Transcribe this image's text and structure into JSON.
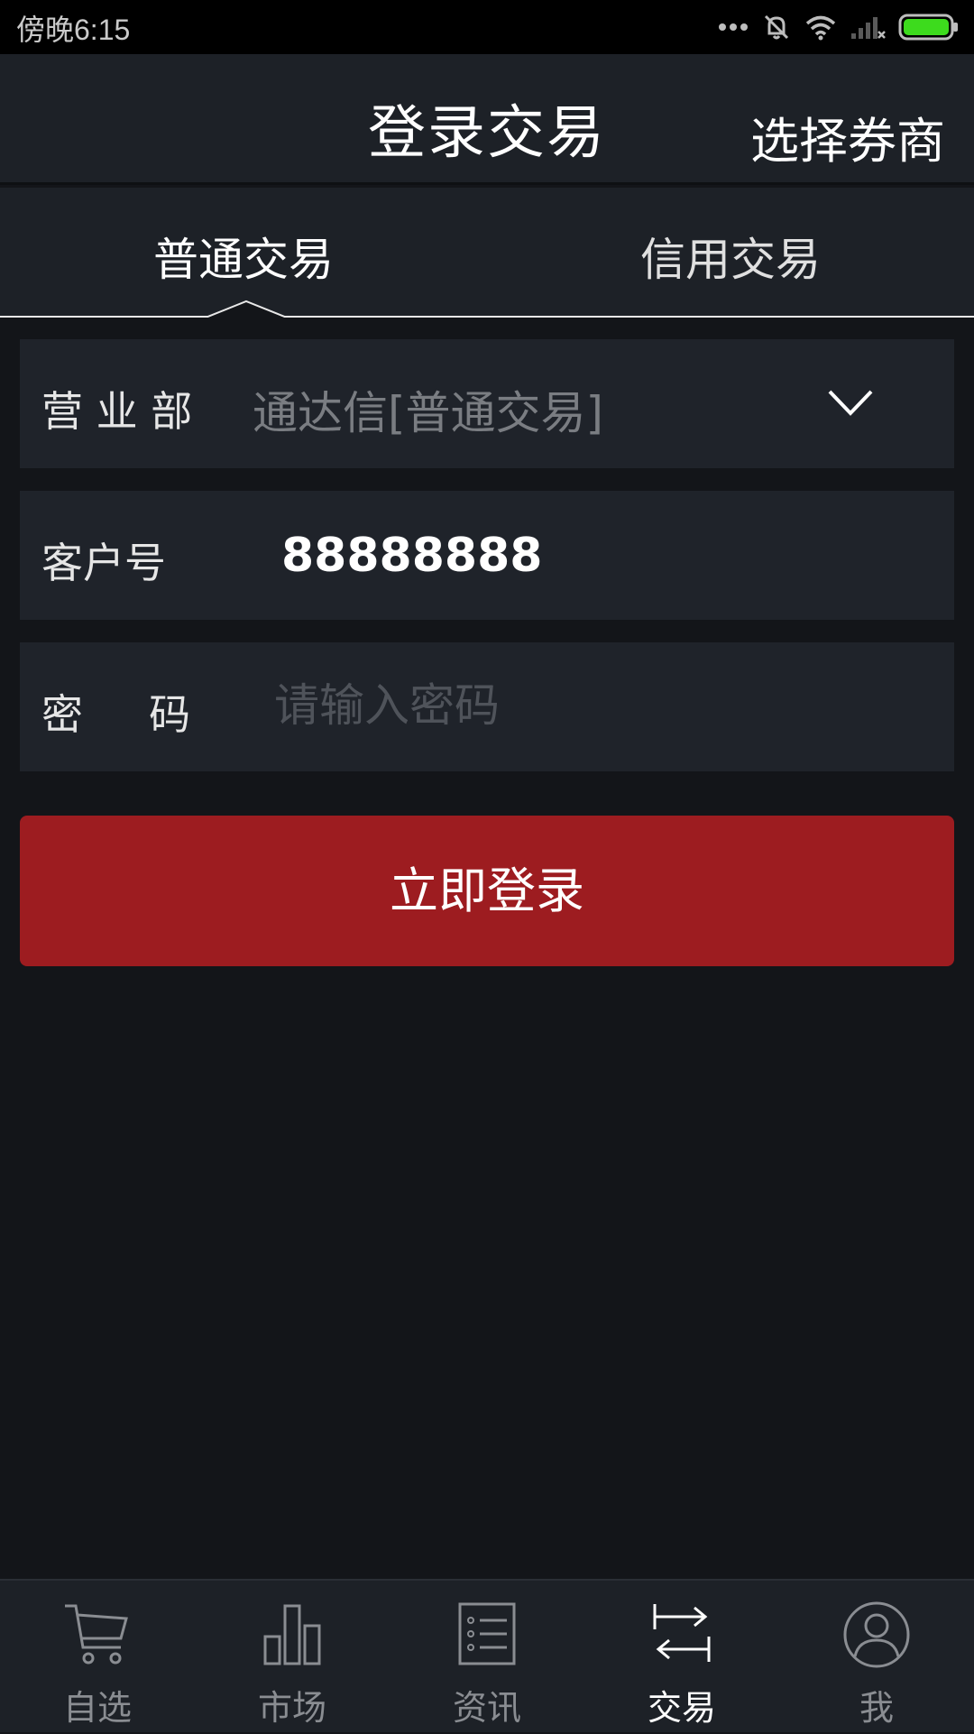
{
  "status_bar": {
    "time": "傍晚6:15"
  },
  "header": {
    "title": "登录交易",
    "action_label": "选择券商"
  },
  "tabs": [
    {
      "label": "普通交易",
      "active": true
    },
    {
      "label": "信用交易",
      "active": false
    }
  ],
  "form": {
    "branch": {
      "label": "营 业 部",
      "value": "通达信[普通交易]"
    },
    "account": {
      "label": "客户号",
      "value": "88888888"
    },
    "password": {
      "label": "密     码",
      "placeholder": "请输入密码"
    }
  },
  "login_button": {
    "label": "立即登录",
    "color": "#9d1c20"
  },
  "bottom_nav": [
    {
      "label": "自选",
      "icon": "cart-icon",
      "active": false
    },
    {
      "label": "市场",
      "icon": "bar-chart-icon",
      "active": false
    },
    {
      "label": "资讯",
      "icon": "news-list-icon",
      "active": false
    },
    {
      "label": "交易",
      "icon": "exchange-arrows-icon",
      "active": true
    },
    {
      "label": "我",
      "icon": "user-icon",
      "active": false
    }
  ]
}
